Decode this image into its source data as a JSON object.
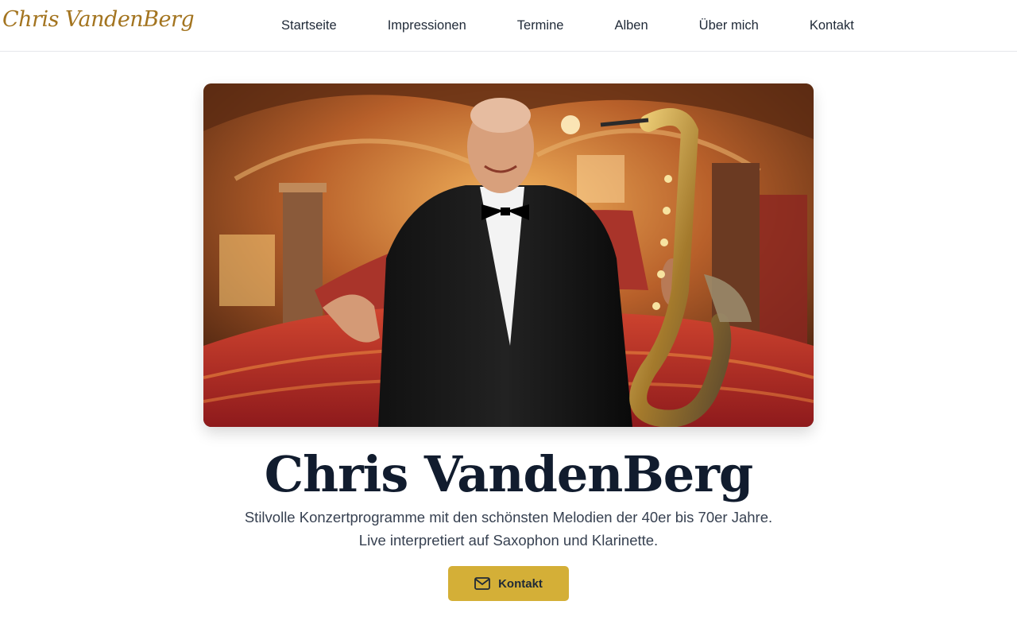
{
  "header": {
    "logo_text": "Chris VandenBerg",
    "nav": [
      {
        "label": "Startseite"
      },
      {
        "label": "Impressionen"
      },
      {
        "label": "Termine"
      },
      {
        "label": "Alben"
      },
      {
        "label": "Über mich"
      },
      {
        "label": "Kontakt"
      }
    ]
  },
  "hero": {
    "image_alt": "Chris VandenBerg mit Saxophon im Theaterfoyer",
    "title": "Chris VandenBerg",
    "tagline_line1": "Stilvolle Konzertprogramme mit den schönsten Melodien der 40er bis 70er Jahre.",
    "tagline_line2": "Live interpretiert auf Saxophon und Klarinette.",
    "cta_label": "Kontakt",
    "cta_icon": "mail-icon"
  },
  "colors": {
    "brand_gold": "#d4af37",
    "logo_gold": "#a3741f",
    "heading": "#111c2e",
    "text": "#374151"
  }
}
